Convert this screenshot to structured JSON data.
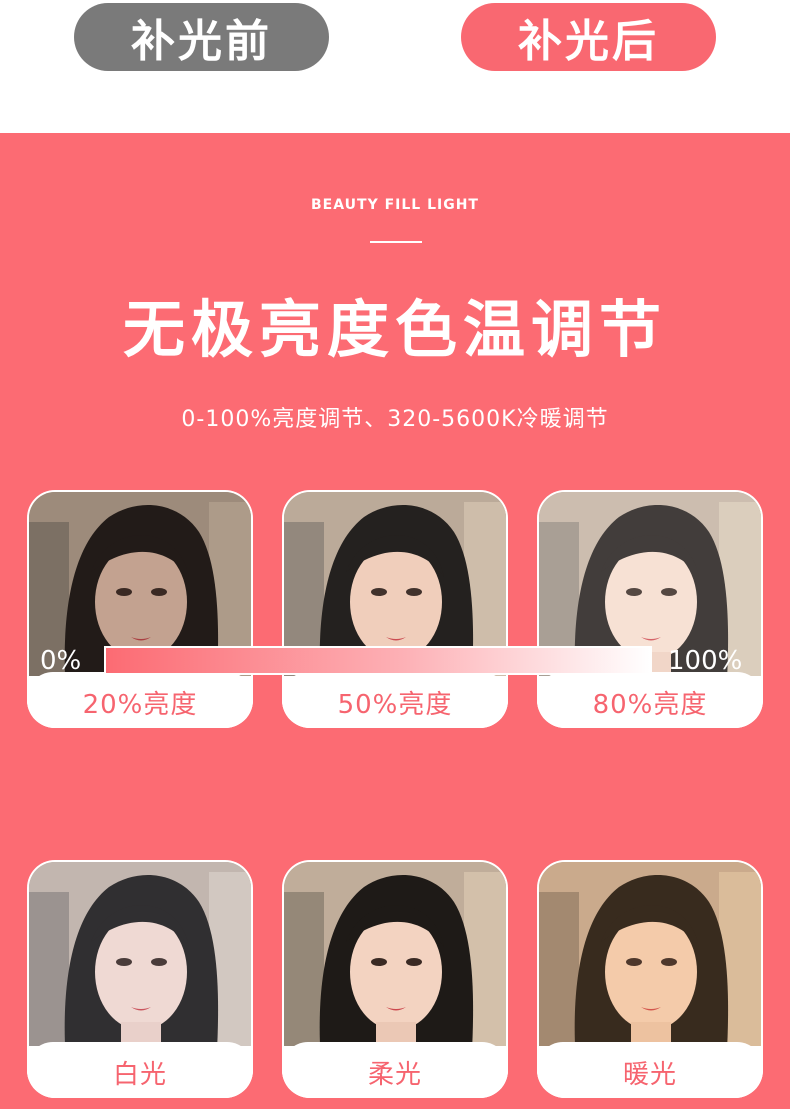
{
  "header": {
    "before_label": "补光前",
    "after_label": "补光后"
  },
  "panel": {
    "eyebrow": "BEAUTY FILL LIGHT",
    "title": "无极亮度色温调节",
    "subtitle": "0-100%亮度调节、320-5600K冷暖调节"
  },
  "brightness_cards": [
    {
      "label": "20%亮度"
    },
    {
      "label": "50%亮度"
    },
    {
      "label": "80%亮度"
    }
  ],
  "brightness_bar": {
    "min_label": "0%",
    "max_label": "100%"
  },
  "color_cards": [
    {
      "label": "白光"
    },
    {
      "label": "柔光"
    },
    {
      "label": "暖光"
    }
  ],
  "colors": {
    "panel": "#fc6b73",
    "before_pill": "#7a7a7a",
    "after_pill": "#f96871",
    "caption_text": "#f6646f"
  }
}
